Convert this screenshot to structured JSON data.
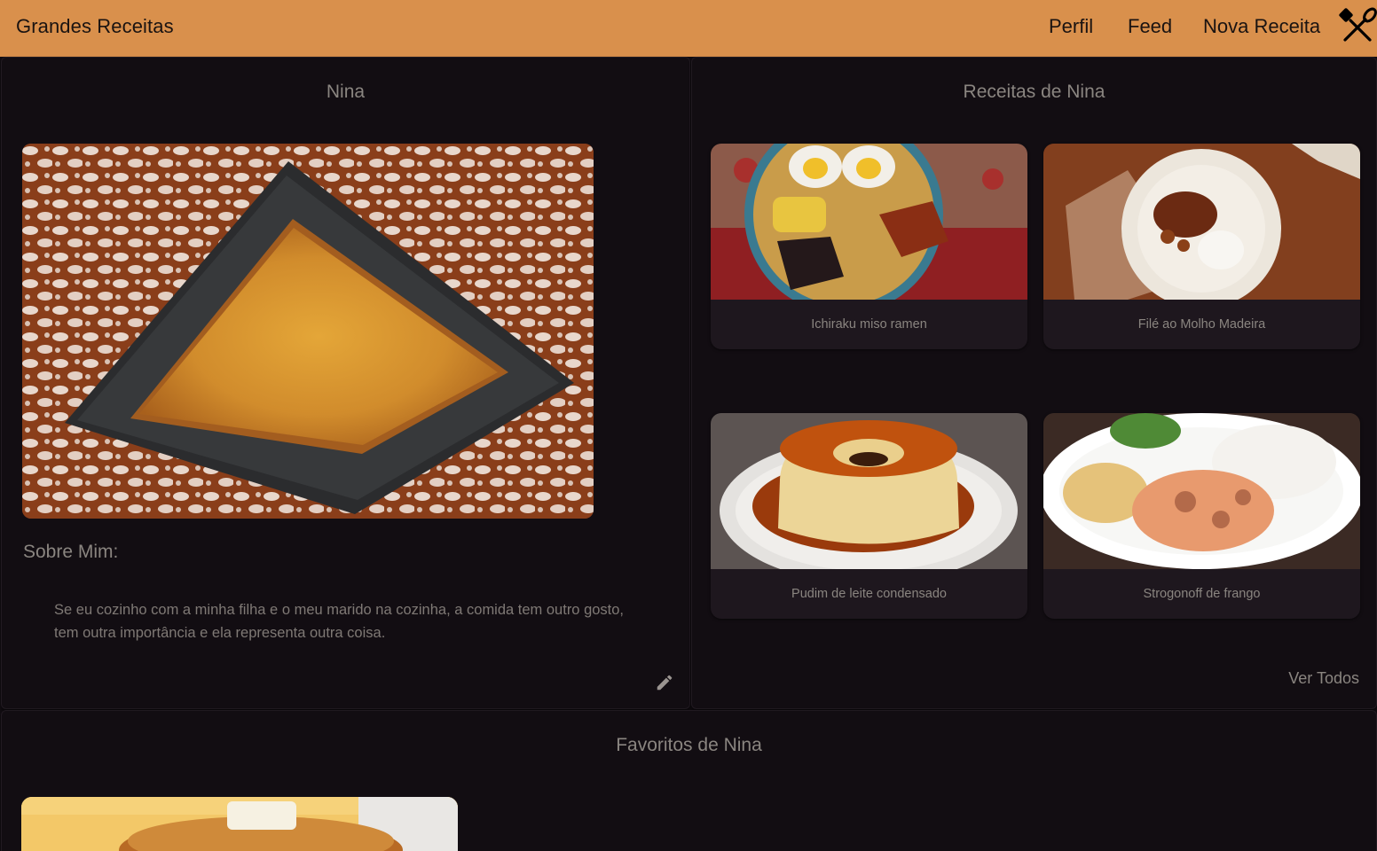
{
  "topbar": {
    "brand": "Grandes Receitas",
    "nav": [
      "Perfil",
      "Feed",
      "Nova Receita"
    ],
    "icon": "crossed-spatula-whisk-icon",
    "background": "#d9904c"
  },
  "profile": {
    "name": "Nina",
    "photo_icon": "lasagna-tray-photo",
    "about_heading": "Sobre Mim:",
    "about_text": "Se eu cozinho com a minha filha e o meu marido na cozinha, a comida tem outro gosto, tem outra importância e ela representa outra coisa.",
    "edit_icon": "pencil-icon"
  },
  "recipes": {
    "title": "Receitas de Nina",
    "items": [
      {
        "label": "Ichiraku miso ramen",
        "icon": "ramen-bowl-photo"
      },
      {
        "label": "Filé ao Molho Madeira",
        "icon": "steak-plate-photo"
      },
      {
        "label": "Pudim de leite condensado",
        "icon": "flan-pudding-photo"
      },
      {
        "label": "Strogonoff de frango",
        "icon": "strogonoff-plate-photo"
      }
    ],
    "see_all": "Ver Todos"
  },
  "favorites": {
    "title": "Favoritos de Nina",
    "items": [
      {
        "icon": "pancakes-photo"
      }
    ]
  }
}
